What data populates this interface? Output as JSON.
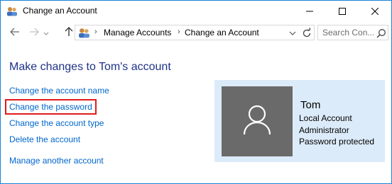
{
  "window": {
    "title": "Change an Account",
    "accent_color": "#1883d7"
  },
  "toolbar": {
    "breadcrumbs": [
      "Manage Accounts",
      "Change an Account"
    ],
    "search_placeholder": "Search Con..."
  },
  "content": {
    "heading": "Make changes to Tom's account",
    "links": [
      "Change the account name",
      "Change the password",
      "Change the account type",
      "Delete the account",
      "Manage another account"
    ],
    "highlighted_link_color": "#e01b1b"
  },
  "account": {
    "name": "Tom",
    "details": [
      "Local Account",
      "Administrator",
      "Password protected"
    ]
  },
  "icons": {
    "app": "users-icon",
    "back": "arrow-left-icon",
    "forward": "arrow-right-icon",
    "up": "arrow-up-icon",
    "refresh": "refresh-icon",
    "search": "search-icon"
  }
}
